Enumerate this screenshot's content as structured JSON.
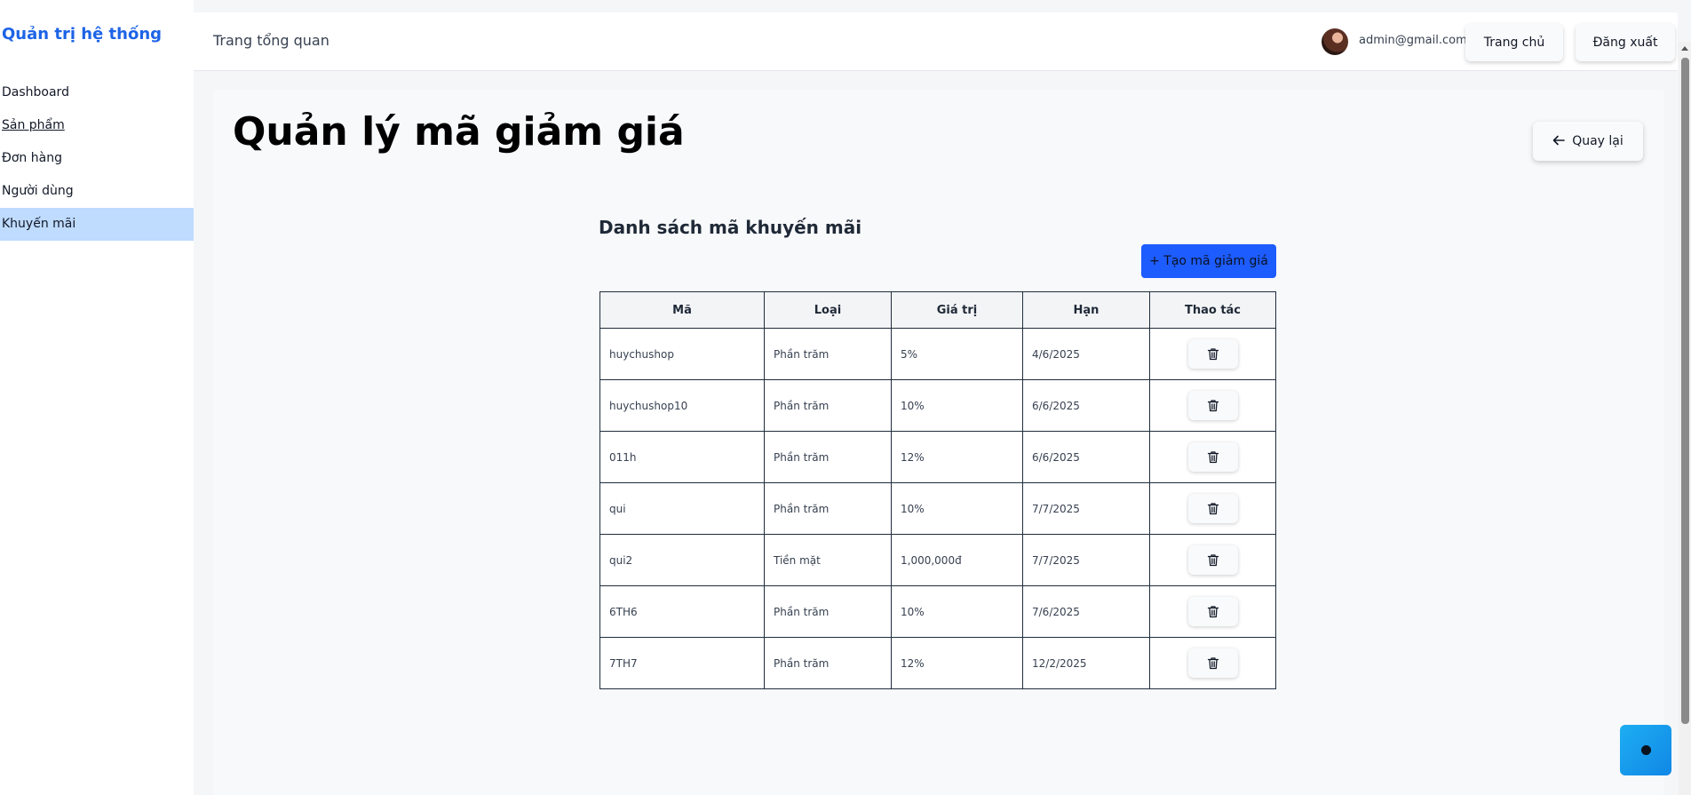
{
  "sidebar": {
    "brand": "Quản trị hệ thống",
    "items": [
      {
        "label": "Dashboard"
      },
      {
        "label": "Sản phẩm"
      },
      {
        "label": "Đơn hàng"
      },
      {
        "label": "Người dùng"
      },
      {
        "label": "Khuyến mãi"
      }
    ]
  },
  "header": {
    "title": "Trang tổng quan",
    "email": "admin@gmail.com",
    "home_label": "Trang chủ",
    "logout_label": "Đăng xuất"
  },
  "main": {
    "title": "Quản lý mã giảm giá",
    "back_label": "Quay lại",
    "list_title": "Danh sách mã khuyến mãi",
    "create_label": "+ Tạo mã giảm giá",
    "columns": [
      "Mã",
      "Loại",
      "Giá trị",
      "Hạn",
      "Thao tác"
    ],
    "rows": [
      [
        "huychushop",
        "Phần trăm",
        "5%",
        "4/6/2025"
      ],
      [
        "huychushop10",
        "Phần trăm",
        "10%",
        "6/6/2025"
      ],
      [
        "011h",
        "Phần trăm",
        "12%",
        "6/6/2025"
      ],
      [
        "qui",
        "Phần trăm",
        "10%",
        "7/7/2025"
      ],
      [
        "qui2",
        "Tiền mặt",
        "1,000,000đ",
        "7/7/2025"
      ],
      [
        "6TH6",
        "Phần trăm",
        "10%",
        "7/6/2025"
      ],
      [
        "7TH7",
        "Phần trăm",
        "12%",
        "12/2/2025"
      ]
    ]
  },
  "icons": {
    "back": "arrow-left-icon",
    "delete": "trash-icon",
    "chat": "chat-icon"
  },
  "colors": {
    "brand": "#1d63e6",
    "active_nav": "#bfdbfe",
    "primary_button": "#1d5cff"
  }
}
